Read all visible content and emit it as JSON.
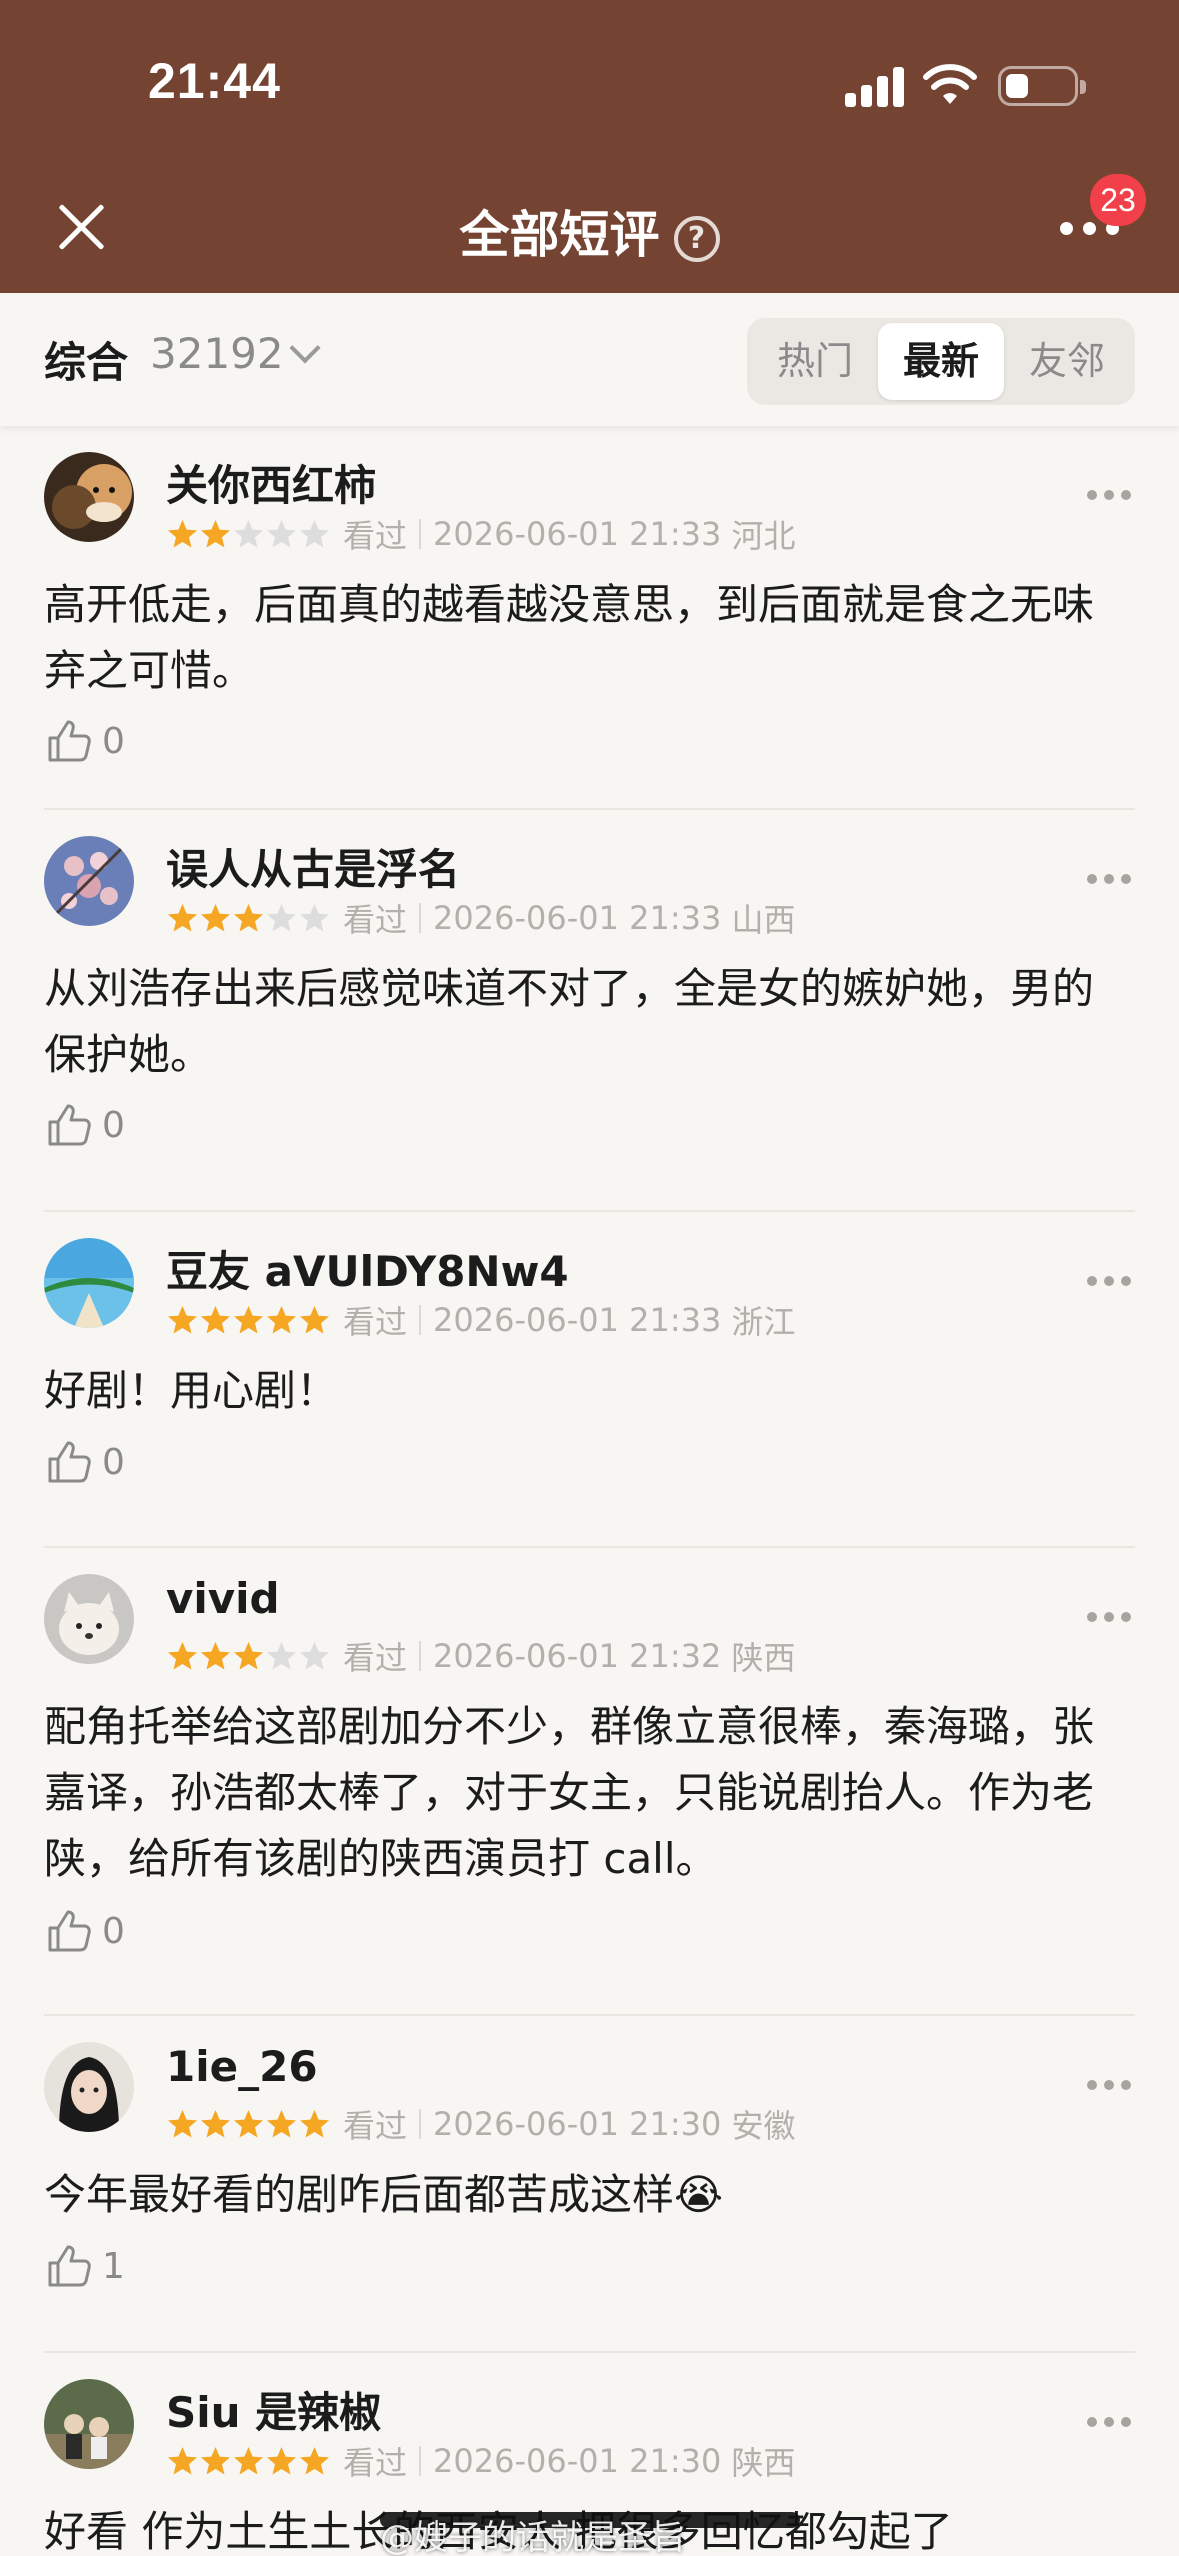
{
  "status_bar": {
    "time": "21:44"
  },
  "header": {
    "title": "全部短评",
    "help_icon": "?",
    "badge_count": "23"
  },
  "filter": {
    "sort_label": "综合",
    "sort_count": "32192",
    "tabs": [
      {
        "label": "热门",
        "active": false
      },
      {
        "label": "最新",
        "active": true
      },
      {
        "label": "友邻",
        "active": false
      }
    ]
  },
  "reviews": [
    {
      "user": "关你西红柿",
      "rating": 2,
      "status": "看过",
      "time": "2026-06-01 21:33",
      "region": "河北",
      "comment": "高开低走，后面真的越看越没意思，到后面就是食之无味弃之可惜。",
      "likes": "0"
    },
    {
      "user": "误人从古是浮名",
      "rating": 3,
      "status": "看过",
      "time": "2026-06-01 21:33",
      "region": "山西",
      "comment": "从刘浩存出来后感觉味道不对了，全是女的嫉妒她，男的保护她。",
      "likes": "0"
    },
    {
      "user": "豆友 aVUlDY8Nw4",
      "rating": 5,
      "status": "看过",
      "time": "2026-06-01 21:33",
      "region": "浙江",
      "comment": "好剧！用心剧！",
      "likes": "0"
    },
    {
      "user": "vivid",
      "rating": 3,
      "status": "看过",
      "time": "2026-06-01 21:32",
      "region": "陕西",
      "comment": "配角托举给这部剧加分不少，群像立意很棒，秦海璐，张嘉译，孙浩都太棒了，对于女主，只能说剧抬人。作为老陕，给所有该剧的陕西演员打 call。",
      "likes": "0"
    },
    {
      "user": "1ie_26",
      "rating": 5,
      "status": "看过",
      "time": "2026-06-01 21:30",
      "region": "安徽",
      "comment": "今年最好看的剧咋后面都苦成这样😭",
      "likes": "1"
    },
    {
      "user": "Siu 是辣椒",
      "rating": 5,
      "status": "看过",
      "time": "2026-06-01 21:30",
      "region": "陕西",
      "comment": "好看 作为土生土长的西安人 把很多回忆都勾起了",
      "likes": ""
    }
  ],
  "watermark": "@嫂子的话就是圣旨",
  "colors": {
    "header_bg": "#744331",
    "star_on": "#f5a623",
    "star_off": "#dddddd",
    "badge": "#f2404b"
  }
}
